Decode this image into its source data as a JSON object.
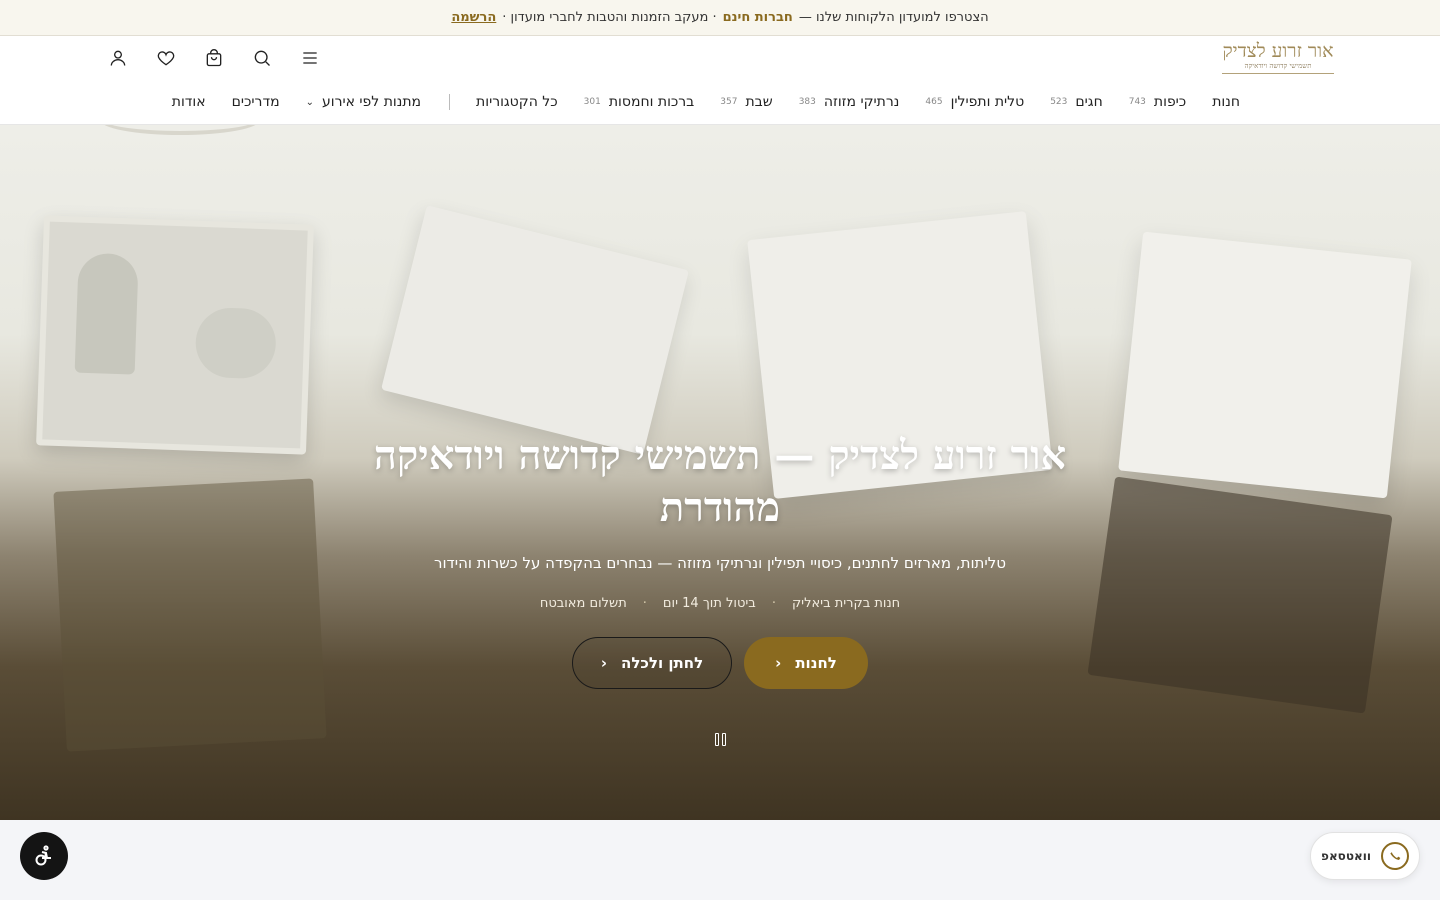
{
  "announcement": {
    "text": "הצטרפו למועדון הלקוחות שלנו —",
    "highlight": "חברות חינם",
    "text2": "· מעקב הזמנות והטבות לחברי מועדון ·",
    "link": "הרשמה"
  },
  "logo": {
    "main": "אור זרוע לצדיק",
    "sub": "תשמישי קדושה ויודאיקה"
  },
  "header_icons": [
    "menu-icon",
    "search-icon",
    "cart-icon",
    "heart-icon",
    "user-icon"
  ],
  "nav": {
    "items": [
      {
        "label": "חנות",
        "count": ""
      },
      {
        "label": "כיפות",
        "count": "743"
      },
      {
        "label": "חגים",
        "count": "523"
      },
      {
        "label": "טלית ותפילין",
        "count": "465"
      },
      {
        "label": "נרתיקי מזוזה",
        "count": "383"
      },
      {
        "label": "שבת",
        "count": "357"
      },
      {
        "label": "ברכות וחמסות",
        "count": "301"
      },
      {
        "label": "כל הקטגוריות",
        "count": ""
      }
    ],
    "extra": [
      {
        "label": "מתנות לפי אירוע"
      },
      {
        "label": "מדריכים"
      },
      {
        "label": "אודות"
      }
    ]
  },
  "hero": {
    "title": "אור זרוע לצדיק — תשמישי קדושה ויודאיקה מהודרת",
    "subtitle": "טליתות, מארזים לחתנים, כיסויי תפילין ונרתיקי מזוזה — נבחרים בהקפדה על כשרות והידור",
    "features": [
      "חנות בקרית ביאליק",
      "ביטול תוך 14 יום",
      "תשלום מאובטח"
    ],
    "cta_primary": "לחנות",
    "cta_secondary": "לחתן ולכלה",
    "brand_color": "#8a6a1f"
  },
  "floating": {
    "whatsapp_label": "וואטסאפ",
    "accessibility_icon": "accessibility-icon"
  }
}
